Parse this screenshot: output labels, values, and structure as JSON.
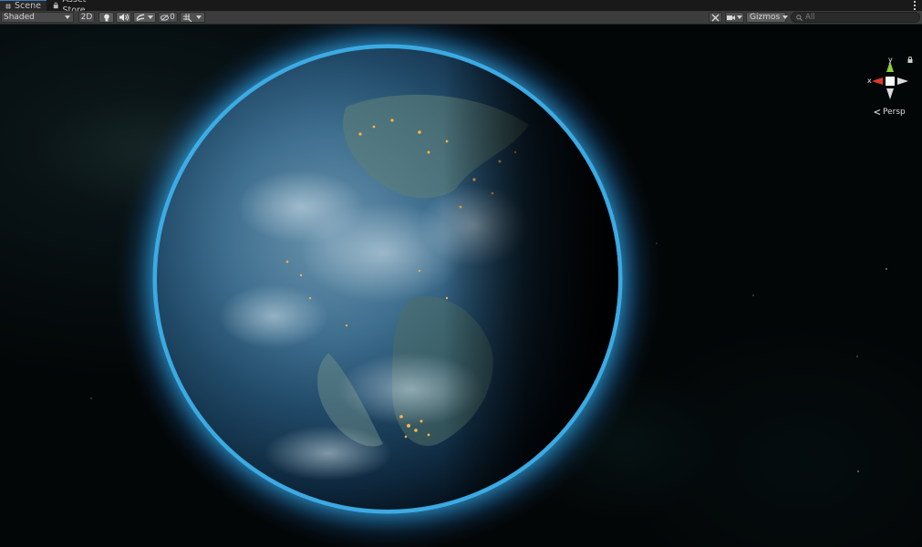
{
  "tabs": [
    {
      "label": "Scene",
      "icon": "grid-icon",
      "active": true
    },
    {
      "label": "Asset Store",
      "icon": "bag-icon",
      "active": false
    }
  ],
  "toolbar": {
    "draw_mode": "Shaded",
    "mode_2d": "2D",
    "hidden_count": "0",
    "gizmos_label": "Gizmos",
    "search_placeholder": "All"
  },
  "gizmo": {
    "x_label": "x",
    "y_label": "y",
    "projection": "Persp",
    "colors": {
      "x_axis": "#e03a2a",
      "y_axis": "#8ccf3a",
      "center": "#ffffff"
    }
  },
  "scene": {
    "object": "earth-globe",
    "background": "#030607",
    "atmosphere_color": "#2ea8ff"
  }
}
